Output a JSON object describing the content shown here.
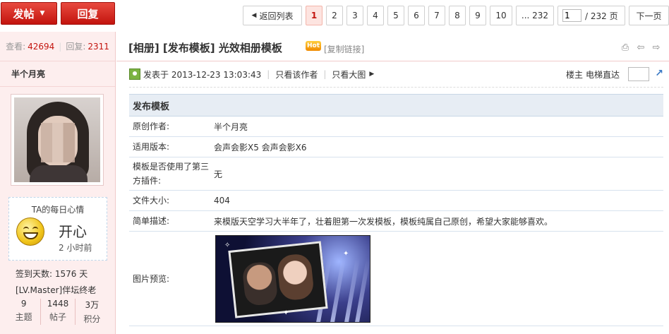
{
  "topbar": {
    "post_label": "发帖",
    "post_caret": "▼",
    "reply_label": "回复",
    "back_label": "返回列表",
    "pages": [
      "1",
      "2",
      "3",
      "4",
      "5",
      "6",
      "7",
      "8",
      "9",
      "10"
    ],
    "current_page": "1",
    "last_page": "... 232",
    "page_input": "1",
    "page_total": "/ 232 页",
    "next_label": "下一页"
  },
  "sidebar": {
    "views_label": "查看:",
    "views": "42694",
    "replies_label": "回复:",
    "replies": "2311",
    "author": "半个月亮",
    "mood_title": "TA的每日心情",
    "mood_word": "开心",
    "mood_time": "2 小时前",
    "signin": "签到天数: 1576 天",
    "level": "[LV.Master]伴坛终老",
    "stats": [
      {
        "value": "9",
        "label": "主题"
      },
      {
        "value": "1448",
        "label": "帖子"
      },
      {
        "value": "3万",
        "label": "积分"
      }
    ]
  },
  "thread": {
    "title": "[相册] [发布模板] 光效相册模板",
    "hot_badge": "Hot",
    "copy_link": "[复制链接]"
  },
  "post": {
    "posted": "发表于 2013-12-23 13:03:43",
    "only_author": "只看该作者",
    "big_image": "只看大图",
    "floor": "楼主",
    "jump_label": "电梯直达"
  },
  "table": {
    "heading": "发布模板",
    "rows": [
      {
        "k": "原创作者:",
        "v": "半个月亮"
      },
      {
        "k": "适用版本:",
        "v": "会声会影X5 会声会影X6"
      },
      {
        "k": "模板是否使用了第三方插件:",
        "v": "无"
      },
      {
        "k": "文件大小:",
        "v": "404"
      },
      {
        "k": "简单描述:",
        "v": "来模版天空学习大半年了，壮着胆第一次发模板，模板纯属自己原创，希望大家能够喜欢。"
      },
      {
        "k": "图片预览:",
        "v": ""
      }
    ]
  }
}
